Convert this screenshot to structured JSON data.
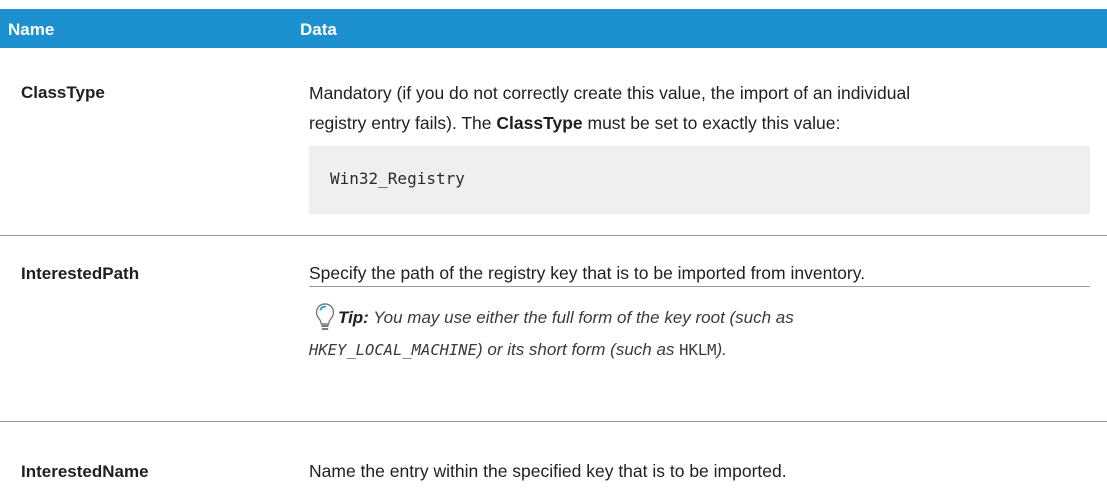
{
  "header": {
    "name": "Name",
    "data": "Data"
  },
  "rows": {
    "classtype": {
      "name": "ClassType",
      "desc_line1": "Mandatory (if you do not correctly create this value, the import of an individual",
      "desc_line2_pre": "registry entry fails). The ",
      "desc_line2_bold": "ClassType",
      "desc_line2_post": " must be set to exactly this value:",
      "code": "Win32_Registry"
    },
    "interestedpath": {
      "name": "InterestedPath",
      "desc": "Specify the path of the registry key that is to be imported from inventory.",
      "tip_label": "Tip:",
      "tip_line1": " You may use either the full form of the key root (such as",
      "tip_code1": "HKEY_LOCAL_MACHINE",
      "tip_mid": ") or its short form (such as ",
      "tip_code2": "HKLM",
      "tip_end": ")."
    },
    "interestedname": {
      "name": "InterestedName",
      "desc": "Name the entry within the specified key that is to be imported."
    }
  },
  "icons": {
    "tip": "lightbulb-icon"
  },
  "colors": {
    "header_bg": "#1d91cf",
    "code_bg": "#efefef"
  }
}
